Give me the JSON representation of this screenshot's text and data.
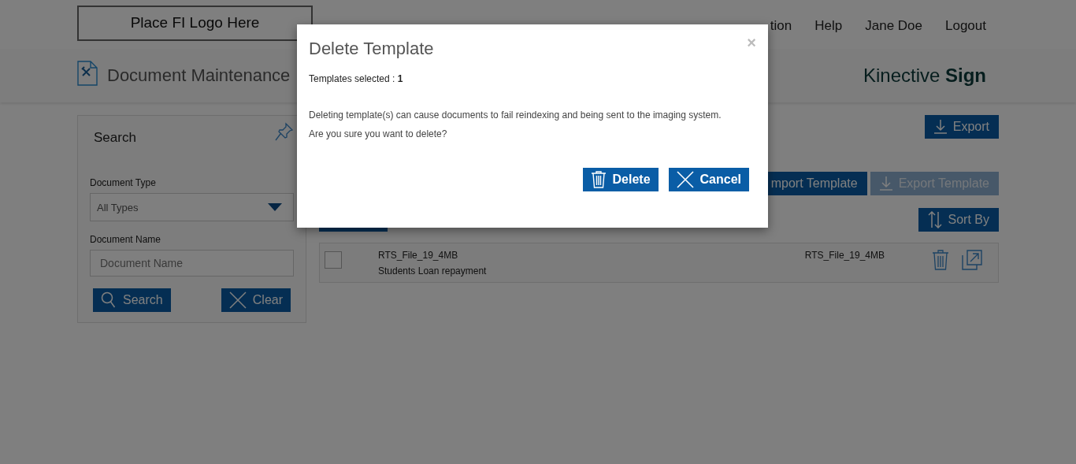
{
  "header": {
    "logo_placeholder": "Place FI Logo Here",
    "nav": [
      "tion",
      "Help",
      "Jane Doe",
      "Logout"
    ]
  },
  "subheader": {
    "title": "Document Maintenance",
    "brand": "Kinective **Sign**"
  },
  "search_panel": {
    "title": "Search",
    "document_type": {
      "label": "Document Type",
      "value": "All Types"
    },
    "document_name": {
      "label": "Document Name",
      "placeholder": "Document Name"
    },
    "buttons": [
      "Search",
      "Clear"
    ]
  },
  "toolbar": {
    "export": "Export",
    "import_template": "mport Template",
    "export_template": {
      "label": "Export Template",
      "disabled": true
    },
    "sort_by": "Sort By"
  },
  "templates": [
    {
      "checked": false,
      "name": "RTS_File_19_4MB",
      "description": "Students Loan repayment",
      "column_3": "RTS_File_19_4MB"
    }
  ],
  "modal": {
    "title": "Delete Template",
    "close": "×",
    "selected": "Templates selected : **1**",
    "message": [
      "Deleting template(s) can cause documents to fail reindexing and being sent to the imaging system.",
      "Are you sure you want to delete?"
    ],
    "buttons": [
      "Delete",
      "Cancel"
    ]
  }
}
